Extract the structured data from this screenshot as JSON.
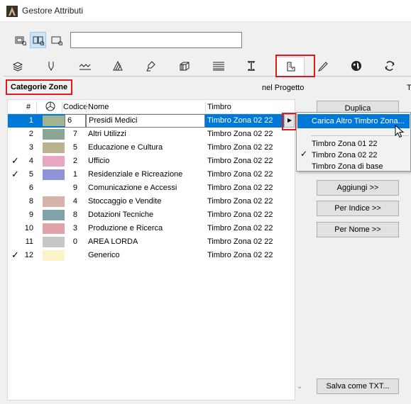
{
  "window": {
    "title": "Gestore Attributi"
  },
  "toolbar": {
    "view_buttons": [
      {
        "icon": "view-list-icon",
        "active": false
      },
      {
        "icon": "view-split-icon",
        "active": true
      },
      {
        "icon": "view-single-icon",
        "active": false
      }
    ],
    "search_value": ""
  },
  "tabs": [
    {
      "icon": "layers-icon"
    },
    {
      "icon": "pen-icon"
    },
    {
      "icon": "line-types-icon"
    },
    {
      "icon": "fills-icon"
    },
    {
      "icon": "surfaces-icon"
    },
    {
      "icon": "composites-icon"
    },
    {
      "icon": "profiles-icon"
    },
    {
      "icon": "columns-icon"
    },
    {
      "icon": "zone-categories-icon",
      "selected": true
    },
    {
      "icon": "markup-icon"
    },
    {
      "icon": "globe-icon"
    },
    {
      "icon": "renovation-icon"
    }
  ],
  "section": {
    "label": "Categorie Zone",
    "project_label": "nel Progetto",
    "right_label": "T"
  },
  "table": {
    "headers": {
      "hash": "#",
      "color": "pie-chart-icon",
      "codice": "Codice",
      "nome": "Nome",
      "timbro": "Timbro"
    },
    "rows": [
      {
        "check": false,
        "num": "1",
        "color": "#a3b38f",
        "codice": "6",
        "nome": "Presidi Medici",
        "timbro": "Timbro Zona 02 22",
        "selected": true
      },
      {
        "check": false,
        "num": "2",
        "color": "#8aa596",
        "codice": "7",
        "nome": "Altri Utilizzi",
        "timbro": "Timbro Zona 02 22"
      },
      {
        "check": false,
        "num": "3",
        "color": "#b9b48f",
        "codice": "5",
        "nome": "Educazione e Cultura",
        "timbro": "Timbro Zona 02 22"
      },
      {
        "check": true,
        "num": "4",
        "color": "#e7a6c2",
        "codice": "2",
        "nome": "Ufficio",
        "timbro": "Timbro Zona 02 22"
      },
      {
        "check": true,
        "num": "5",
        "color": "#9193d8",
        "codice": "1",
        "nome": "Residenziale e Ricreazione",
        "timbro": "Timbro Zona 02 22"
      },
      {
        "check": false,
        "num": "6",
        "color": "",
        "codice": "9",
        "nome": "Comunicazione e Accessi",
        "timbro": "Timbro Zona 02 22"
      },
      {
        "check": false,
        "num": "8",
        "color": "#d5b3a8",
        "codice": "4",
        "nome": "Stoccaggio e Vendite",
        "timbro": "Timbro Zona 02 22"
      },
      {
        "check": false,
        "num": "9",
        "color": "#7fa3a9",
        "codice": "8",
        "nome": "Dotazioni Tecniche",
        "timbro": "Timbro Zona 02 22"
      },
      {
        "check": false,
        "num": "10",
        "color": "#dfa3a8",
        "codice": "3",
        "nome": "Produzione e Ricerca",
        "timbro": "Timbro Zona 02 22"
      },
      {
        "check": false,
        "num": "11",
        "color": "#c6c6c6",
        "codice": "0",
        "nome": "AREA LORDA",
        "timbro": "Timbro Zona 02 22"
      },
      {
        "check": true,
        "num": "12",
        "color": "#fdf3c9",
        "codice": "",
        "nome": "Generico",
        "timbro": "Timbro Zona 02 22"
      }
    ]
  },
  "buttons": {
    "duplica": "Duplica",
    "aggiungi": "Aggiungi >>",
    "per_indice": "Per Indice >>",
    "per_nome": "Per Nome >>",
    "salva": "Salva come TXT..."
  },
  "popup_menu": {
    "load": "Carica Altro Timbro Zona...",
    "items": [
      {
        "label": "Timbro Zona 01 22",
        "checked": false
      },
      {
        "label": "Timbro Zona 02 22",
        "checked": true
      },
      {
        "label": "Timbro Zona di base",
        "checked": false
      }
    ]
  },
  "colors": {
    "accent": "#0078d7",
    "highlight_red": "#e0191d"
  }
}
